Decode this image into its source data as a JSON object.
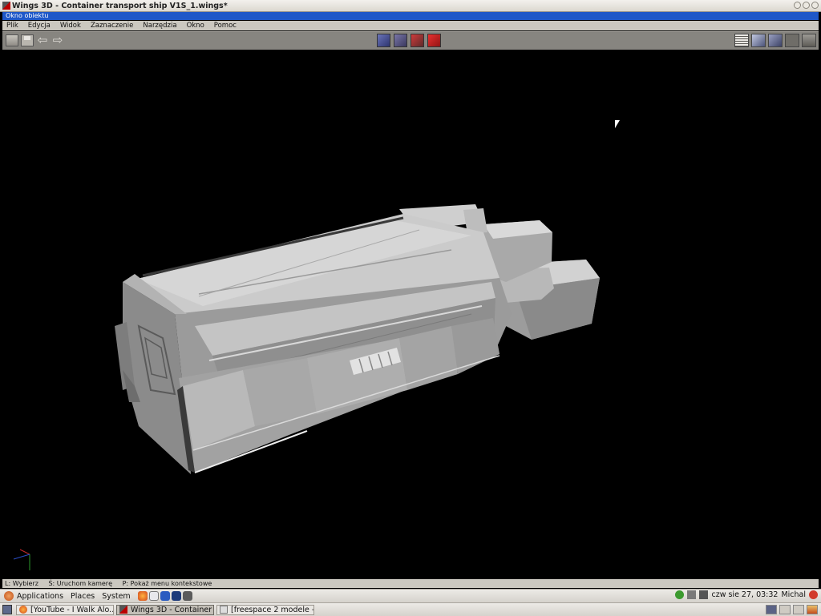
{
  "window": {
    "title": "Wings 3D - Container transport ship V1S_1.wings*",
    "icon": "wings3d-icon",
    "controls": [
      "minimize-icon",
      "maximize-icon",
      "close-icon"
    ]
  },
  "geometry_window": {
    "title": "Okno obiektu"
  },
  "menu": {
    "items": [
      {
        "label": "Plik"
      },
      {
        "label": "Edycja"
      },
      {
        "label": "Widok"
      },
      {
        "label": "Zaznaczenie"
      },
      {
        "label": "Narzędzia"
      },
      {
        "label": "Okno"
      },
      {
        "label": "Pomoc"
      }
    ]
  },
  "toolbar": {
    "left": [
      "open-folder-icon",
      "save-icon",
      "undo-arrow-icon",
      "redo-arrow-icon"
    ],
    "selection_modes": [
      "vertex-mode-icon",
      "edge-mode-icon",
      "face-mode-icon",
      "body-mode-icon"
    ],
    "active_selection_mode": "face-mode-icon",
    "view_buttons": [
      "outliner-icon",
      "smooth-preview-icon",
      "wireframe-cube-icon",
      "ground-grid-icon",
      "perspective-icon"
    ]
  },
  "status": {
    "left_click": "L: Wybierz",
    "middle_click": "Ś: Uruchom kamerę",
    "right_click": "P: Pokaż menu kontekstowe"
  },
  "panel": {
    "menus": [
      {
        "label": "Applications"
      },
      {
        "label": "Places"
      },
      {
        "label": "System"
      }
    ],
    "launchers": [
      "firefox-icon",
      "mail-icon",
      "help-icon",
      "terminal-icon",
      "screenshot-icon"
    ],
    "clock": "czw sie 27, 03:32",
    "user": "Michal"
  },
  "taskbar": {
    "tasks": [
      {
        "label": "[YouTube - I Walk Alo...",
        "icon": "firefox-icon",
        "active": false
      },
      {
        "label": "Wings 3D - Container ...",
        "icon": "wings3d-icon",
        "active": true
      },
      {
        "label": "[freespace 2 modele -...",
        "icon": "document-icon",
        "active": false
      }
    ]
  },
  "colors": {
    "viewport_bg": "#000000",
    "subwindow_title": "#1e57c8",
    "model_light": "#d4d4d4",
    "model_mid": "#a6a6a6",
    "model_dark": "#6e6e6e"
  }
}
